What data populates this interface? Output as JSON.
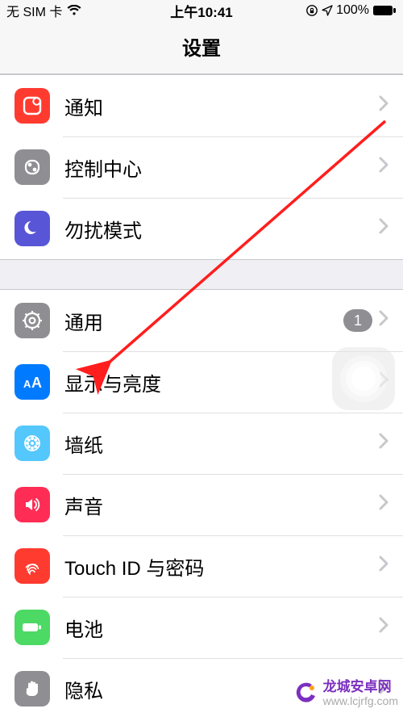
{
  "status": {
    "carrier": "无 SIM 卡",
    "time": "上午10:41",
    "battery_pct": "100%"
  },
  "header": {
    "title": "设置"
  },
  "groups": [
    {
      "rows": [
        {
          "key": "notifications",
          "label": "通知"
        },
        {
          "key": "controlcenter",
          "label": "控制中心"
        },
        {
          "key": "dnd",
          "label": "勿扰模式"
        }
      ]
    },
    {
      "rows": [
        {
          "key": "general",
          "label": "通用",
          "badge": "1"
        },
        {
          "key": "display",
          "label": "显示与亮度"
        },
        {
          "key": "wallpaper",
          "label": "墙纸"
        },
        {
          "key": "sound",
          "label": "声音"
        },
        {
          "key": "touchid",
          "label": "Touch ID 与密码"
        },
        {
          "key": "battery",
          "label": "电池"
        },
        {
          "key": "privacy",
          "label": "隐私"
        }
      ]
    }
  ],
  "watermark": {
    "brand": "龙城安卓网",
    "url": "www.lcjrfg.com"
  }
}
